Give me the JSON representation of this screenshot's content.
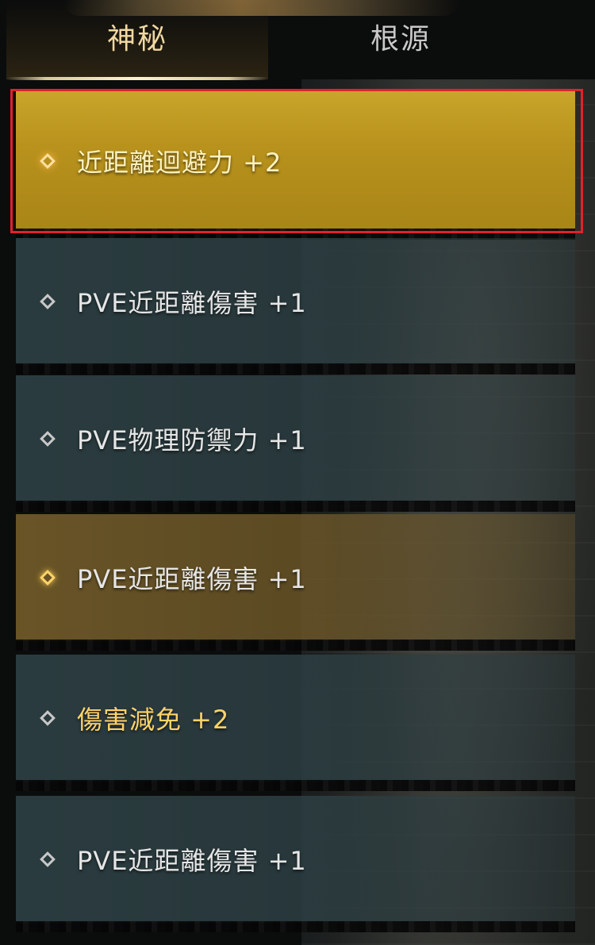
{
  "tabs": [
    {
      "label": "神秘",
      "active": true
    },
    {
      "label": "根源",
      "active": false
    }
  ],
  "items": [
    {
      "label": "近距離迴避力 +2",
      "style": "selected"
    },
    {
      "label": "PVE近距離傷害 +1",
      "style": "normal"
    },
    {
      "label": "PVE物理防禦力 +1",
      "style": "normal"
    },
    {
      "label": "PVE近距離傷害 +1",
      "style": "gold-row"
    },
    {
      "label": "傷害減免 +2",
      "style": "gold-text"
    },
    {
      "label": "PVE近距離傷害 +1",
      "style": "normal"
    }
  ],
  "colors": {
    "selection_outline": "#e0222b",
    "gold_text": "#ffd36a",
    "teal_row": "#2c3e42"
  }
}
